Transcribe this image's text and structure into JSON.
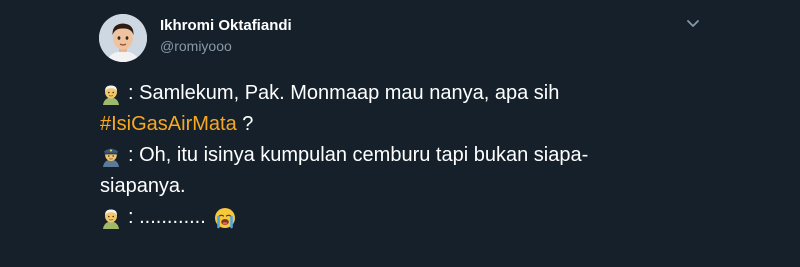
{
  "author": {
    "display_name": "Ikhromi Oktafiandi",
    "username": "@romiyooo"
  },
  "tweet": {
    "line1_text": ": Samlekum, Pak. Monmaap mau nanya, apa sih",
    "hashtag": "#IsiGasAirMata",
    "line2_suffix": " ?",
    "line3_text": ": Oh, itu isinya kumpulan cemburu tapi bukan siapa-",
    "line4_text": "siapanya.",
    "line5_text": ": ............"
  },
  "icons": {
    "speaker1": "old-man-emoji-icon",
    "speaker2": "police-officer-emoji-icon",
    "reaction": "loudly-crying-face-emoji-icon",
    "menu": "chevron-down-icon"
  },
  "colors": {
    "background": "#15202b",
    "hashtag": "#f7a820",
    "secondary_text": "#8899a6"
  }
}
